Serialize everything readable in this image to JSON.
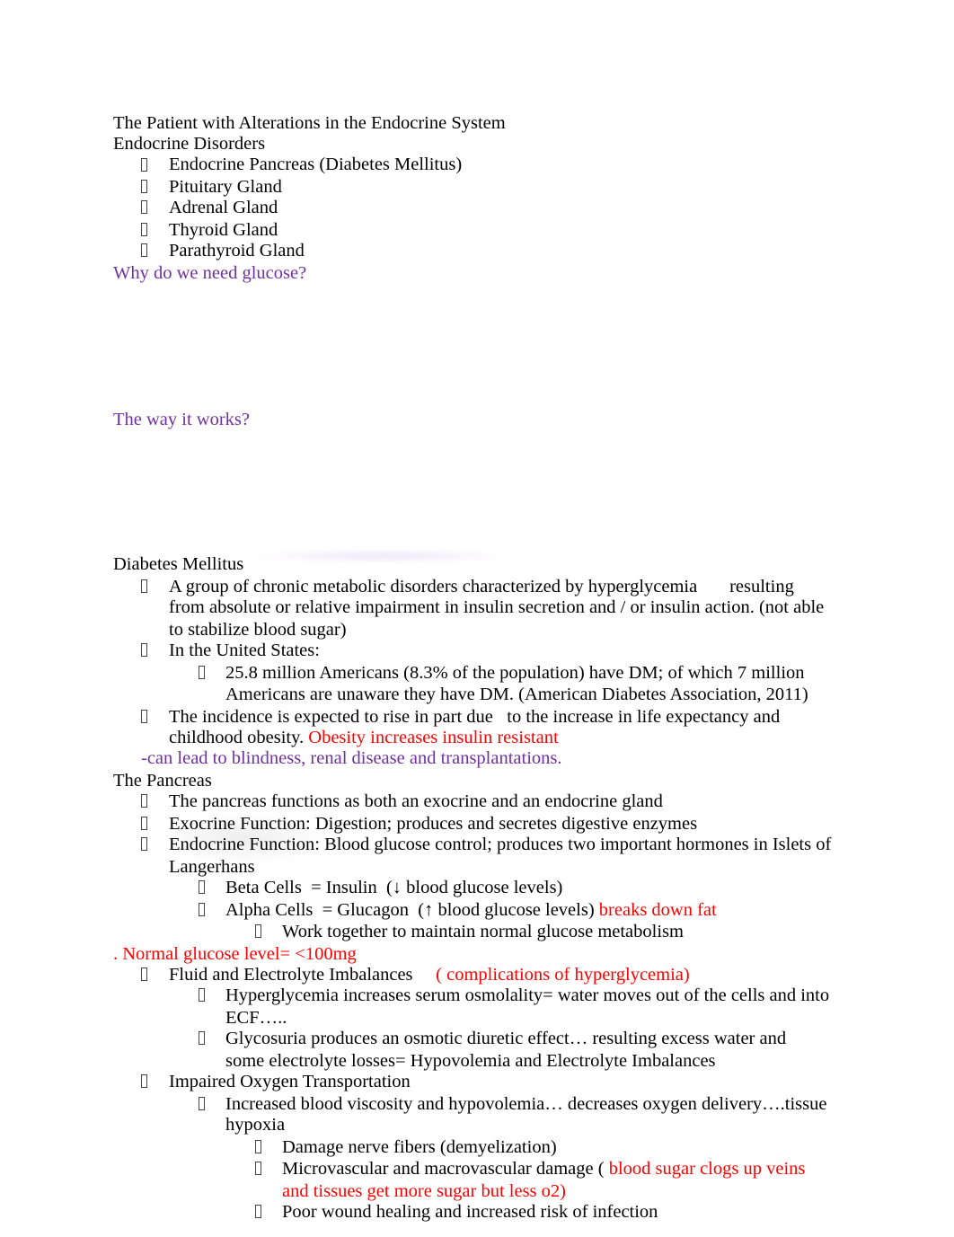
{
  "document": {
    "title": "The Patient with Alterations in the Endocrine System",
    "section_endocrine_disorders": {
      "heading": "Endocrine Disorders",
      "items": [
        "Endocrine Pancreas (Diabetes Mellitus)",
        "Pituitary Gland",
        "Adrenal Gland",
        "Thyroid Gland",
        "Parathyroid Gland"
      ]
    },
    "question_glucose": "Why do we need glucose?",
    "question_how": "The way it works?",
    "section_dm": {
      "heading": "Diabetes Mellitus",
      "def_line1": "A group of chronic metabolic disorders characterized by hyperglycemia       resulting",
      "def_line2": "from absolute or relative impairment in insulin secretion and / or insulin action. (not able",
      "def_line3": "to stabilize blood sugar)",
      "us_label": "In the United States:",
      "stat_line1": "25.8 million Americans (8.3% of the population) have DM; of which 7 million",
      "stat_line2": "Americans are unaware they have DM. (American Diabetes Association, 2011)",
      "incidence_line1": "The incidence is expected to rise in part due   to the increase in life expectancy and",
      "incidence_line2": "childhood obesity. ",
      "incidence_note": "Obesity increases insulin resistant",
      "complications_note": "-can lead to blindness, renal disease and transplantations."
    },
    "section_pancreas": {
      "heading": "The Pancreas",
      "item1": "The pancreas functions as both an exocrine and an endocrine gland",
      "item2": "Exocrine Function: Digestion; produces and secretes digestive enzymes",
      "item3_line1": "Endocrine Function: Blood glucose control; produces two important hormones in Islets of",
      "item3_line2": "Langerhans",
      "beta": "Beta Cells  = Insulin  (↓ blood glucose levels)",
      "alpha": "Alpha Cells  = Glucagon  (↑ blood glucose levels) ",
      "alpha_note": "breaks down fat",
      "together": "Work together to maintain normal glucose metabolism",
      "normal_level": ". Normal glucose level= <100mg"
    },
    "section_fluid": {
      "heading": "Fluid and Electrolyte Imbalances     ",
      "heading_note": "( complications of hyperglycemia)",
      "hyper_line1": "Hyperglycemia increases serum osmolality= water moves out of the cells and into",
      "hyper_line2": "ECF…..",
      "glyco_line1": "Glycosuria produces an osmotic diuretic effect… resulting excess water and",
      "glyco_line2": "some electrolyte losses= Hypovolemia and Electrolyte Imbalances"
    },
    "section_oxygen": {
      "heading": "Impaired Oxygen Transportation",
      "visc_line1": "Increased blood viscosity and hypovolemia… decreases oxygen delivery….tissue",
      "visc_line2": "hypoxia",
      "nerve": "Damage nerve fibers (demyelization)",
      "vascular_line1": "Microvascular and macrovascular damage ( ",
      "vascular_note1": "blood sugar clogs up veins",
      "vascular_note2": "and tissues get more sugar but less o2)",
      "wound": "Poor wound healing and increased risk of infection"
    },
    "colors": {
      "purple_text": "#7030A0",
      "red_text": "#FF0000"
    },
    "bullet_icon": "missing-glyph-box"
  }
}
